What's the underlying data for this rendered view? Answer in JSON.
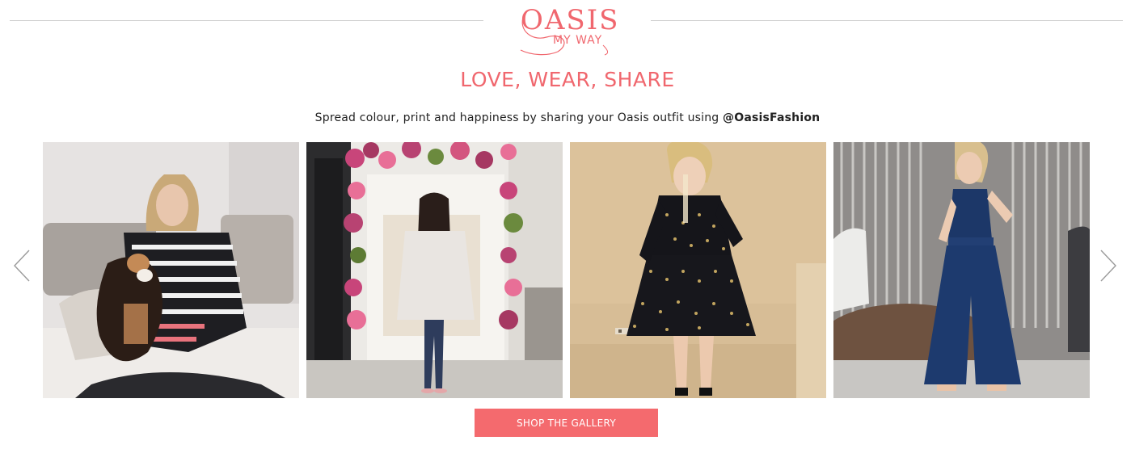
{
  "brand": {
    "logo_main": "OASIS",
    "logo_sub": "MY WAY",
    "accent_color": "#f0676e"
  },
  "section": {
    "headline": "LOVE, WEAR, SHARE",
    "intro_text": "Spread colour, print and happiness by sharing your Oasis outfit using ",
    "intro_handle": "@OasisFashion"
  },
  "carousel": {
    "prev_icon": "chevron-left-icon",
    "next_icon": "chevron-right-icon",
    "tiles": [
      {
        "subject": "woman in striped jumper with dog"
      },
      {
        "subject": "woman in coat by flower doorway"
      },
      {
        "subject": "woman in black spotted dress"
      },
      {
        "subject": "woman in navy jumpsuit"
      }
    ]
  },
  "cta": {
    "label": "SHOP THE GALLERY",
    "color": "#f46a6e"
  }
}
